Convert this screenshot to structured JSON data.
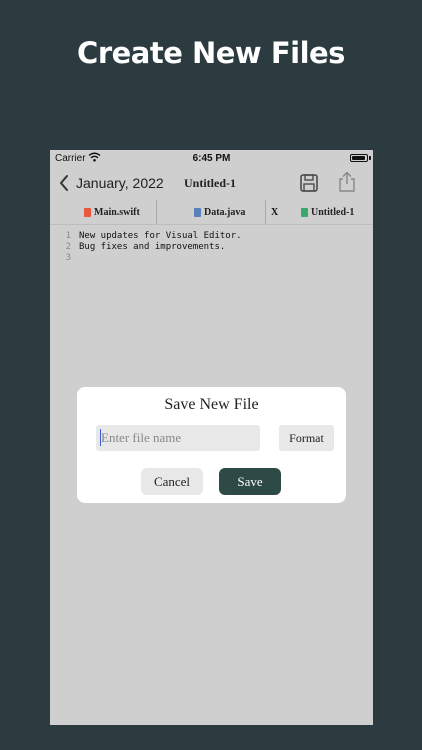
{
  "promo": {
    "title": "Create New Files"
  },
  "status": {
    "carrier": "Carrier",
    "time": "6:45 PM"
  },
  "nav": {
    "back_label": "January, 2022",
    "title": "Untitled-1"
  },
  "tabs": [
    {
      "label": "Main.swift",
      "icon": "swift-file-icon",
      "icon_color": "#e8573b"
    },
    {
      "label": "Data.java",
      "icon": "java-file-icon",
      "icon_color": "#5b7fb8"
    },
    {
      "label": "Untitled-1",
      "icon": "text-file-icon",
      "icon_color": "#3aa86b"
    }
  ],
  "tab_close_label": "X",
  "editor": {
    "lines": [
      {
        "no": "1",
        "text": "New updates for Visual Editor."
      },
      {
        "no": "2",
        "text": "Bug fixes and improvements."
      },
      {
        "no": "3",
        "text": ""
      }
    ]
  },
  "dialog": {
    "title": "Save New File",
    "input_placeholder": "Enter file name",
    "input_value": "",
    "format_label": "Format",
    "cancel_label": "Cancel",
    "save_label": "Save"
  },
  "colors": {
    "background": "#2b3b40",
    "screen": "#cfcfcf",
    "save_button": "#2e4a46"
  }
}
